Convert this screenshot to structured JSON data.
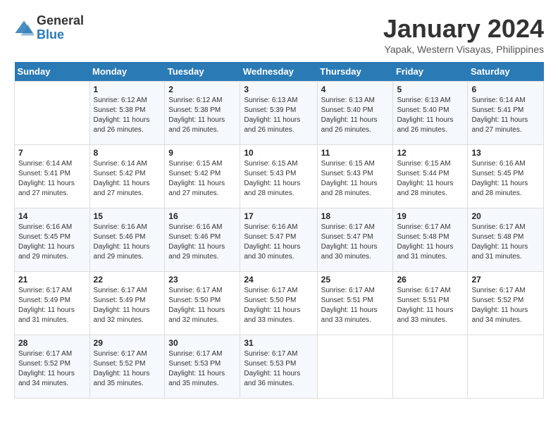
{
  "logo": {
    "text_general": "General",
    "text_blue": "Blue"
  },
  "calendar": {
    "title": "January 2024",
    "subtitle": "Yapak, Western Visayas, Philippines",
    "days_of_week": [
      "Sunday",
      "Monday",
      "Tuesday",
      "Wednesday",
      "Thursday",
      "Friday",
      "Saturday"
    ],
    "weeks": [
      [
        {
          "day": "",
          "sunrise": "",
          "sunset": "",
          "daylight": ""
        },
        {
          "day": "1",
          "sunrise": "Sunrise: 6:12 AM",
          "sunset": "Sunset: 5:38 PM",
          "daylight": "Daylight: 11 hours and 26 minutes."
        },
        {
          "day": "2",
          "sunrise": "Sunrise: 6:12 AM",
          "sunset": "Sunset: 5:38 PM",
          "daylight": "Daylight: 11 hours and 26 minutes."
        },
        {
          "day": "3",
          "sunrise": "Sunrise: 6:13 AM",
          "sunset": "Sunset: 5:39 PM",
          "daylight": "Daylight: 11 hours and 26 minutes."
        },
        {
          "day": "4",
          "sunrise": "Sunrise: 6:13 AM",
          "sunset": "Sunset: 5:40 PM",
          "daylight": "Daylight: 11 hours and 26 minutes."
        },
        {
          "day": "5",
          "sunrise": "Sunrise: 6:13 AM",
          "sunset": "Sunset: 5:40 PM",
          "daylight": "Daylight: 11 hours and 26 minutes."
        },
        {
          "day": "6",
          "sunrise": "Sunrise: 6:14 AM",
          "sunset": "Sunset: 5:41 PM",
          "daylight": "Daylight: 11 hours and 27 minutes."
        }
      ],
      [
        {
          "day": "7",
          "sunrise": "Sunrise: 6:14 AM",
          "sunset": "Sunset: 5:41 PM",
          "daylight": "Daylight: 11 hours and 27 minutes."
        },
        {
          "day": "8",
          "sunrise": "Sunrise: 6:14 AM",
          "sunset": "Sunset: 5:42 PM",
          "daylight": "Daylight: 11 hours and 27 minutes."
        },
        {
          "day": "9",
          "sunrise": "Sunrise: 6:15 AM",
          "sunset": "Sunset: 5:42 PM",
          "daylight": "Daylight: 11 hours and 27 minutes."
        },
        {
          "day": "10",
          "sunrise": "Sunrise: 6:15 AM",
          "sunset": "Sunset: 5:43 PM",
          "daylight": "Daylight: 11 hours and 28 minutes."
        },
        {
          "day": "11",
          "sunrise": "Sunrise: 6:15 AM",
          "sunset": "Sunset: 5:43 PM",
          "daylight": "Daylight: 11 hours and 28 minutes."
        },
        {
          "day": "12",
          "sunrise": "Sunrise: 6:15 AM",
          "sunset": "Sunset: 5:44 PM",
          "daylight": "Daylight: 11 hours and 28 minutes."
        },
        {
          "day": "13",
          "sunrise": "Sunrise: 6:16 AM",
          "sunset": "Sunset: 5:45 PM",
          "daylight": "Daylight: 11 hours and 28 minutes."
        }
      ],
      [
        {
          "day": "14",
          "sunrise": "Sunrise: 6:16 AM",
          "sunset": "Sunset: 5:45 PM",
          "daylight": "Daylight: 11 hours and 29 minutes."
        },
        {
          "day": "15",
          "sunrise": "Sunrise: 6:16 AM",
          "sunset": "Sunset: 5:46 PM",
          "daylight": "Daylight: 11 hours and 29 minutes."
        },
        {
          "day": "16",
          "sunrise": "Sunrise: 6:16 AM",
          "sunset": "Sunset: 5:46 PM",
          "daylight": "Daylight: 11 hours and 29 minutes."
        },
        {
          "day": "17",
          "sunrise": "Sunrise: 6:16 AM",
          "sunset": "Sunset: 5:47 PM",
          "daylight": "Daylight: 11 hours and 30 minutes."
        },
        {
          "day": "18",
          "sunrise": "Sunrise: 6:17 AM",
          "sunset": "Sunset: 5:47 PM",
          "daylight": "Daylight: 11 hours and 30 minutes."
        },
        {
          "day": "19",
          "sunrise": "Sunrise: 6:17 AM",
          "sunset": "Sunset: 5:48 PM",
          "daylight": "Daylight: 11 hours and 31 minutes."
        },
        {
          "day": "20",
          "sunrise": "Sunrise: 6:17 AM",
          "sunset": "Sunset: 5:48 PM",
          "daylight": "Daylight: 11 hours and 31 minutes."
        }
      ],
      [
        {
          "day": "21",
          "sunrise": "Sunrise: 6:17 AM",
          "sunset": "Sunset: 5:49 PM",
          "daylight": "Daylight: 11 hours and 31 minutes."
        },
        {
          "day": "22",
          "sunrise": "Sunrise: 6:17 AM",
          "sunset": "Sunset: 5:49 PM",
          "daylight": "Daylight: 11 hours and 32 minutes."
        },
        {
          "day": "23",
          "sunrise": "Sunrise: 6:17 AM",
          "sunset": "Sunset: 5:50 PM",
          "daylight": "Daylight: 11 hours and 32 minutes."
        },
        {
          "day": "24",
          "sunrise": "Sunrise: 6:17 AM",
          "sunset": "Sunset: 5:50 PM",
          "daylight": "Daylight: 11 hours and 33 minutes."
        },
        {
          "day": "25",
          "sunrise": "Sunrise: 6:17 AM",
          "sunset": "Sunset: 5:51 PM",
          "daylight": "Daylight: 11 hours and 33 minutes."
        },
        {
          "day": "26",
          "sunrise": "Sunrise: 6:17 AM",
          "sunset": "Sunset: 5:51 PM",
          "daylight": "Daylight: 11 hours and 33 minutes."
        },
        {
          "day": "27",
          "sunrise": "Sunrise: 6:17 AM",
          "sunset": "Sunset: 5:52 PM",
          "daylight": "Daylight: 11 hours and 34 minutes."
        }
      ],
      [
        {
          "day": "28",
          "sunrise": "Sunrise: 6:17 AM",
          "sunset": "Sunset: 5:52 PM",
          "daylight": "Daylight: 11 hours and 34 minutes."
        },
        {
          "day": "29",
          "sunrise": "Sunrise: 6:17 AM",
          "sunset": "Sunset: 5:52 PM",
          "daylight": "Daylight: 11 hours and 35 minutes."
        },
        {
          "day": "30",
          "sunrise": "Sunrise: 6:17 AM",
          "sunset": "Sunset: 5:53 PM",
          "daylight": "Daylight: 11 hours and 35 minutes."
        },
        {
          "day": "31",
          "sunrise": "Sunrise: 6:17 AM",
          "sunset": "Sunset: 5:53 PM",
          "daylight": "Daylight: 11 hours and 36 minutes."
        },
        {
          "day": "",
          "sunrise": "",
          "sunset": "",
          "daylight": ""
        },
        {
          "day": "",
          "sunrise": "",
          "sunset": "",
          "daylight": ""
        },
        {
          "day": "",
          "sunrise": "",
          "sunset": "",
          "daylight": ""
        }
      ]
    ]
  }
}
